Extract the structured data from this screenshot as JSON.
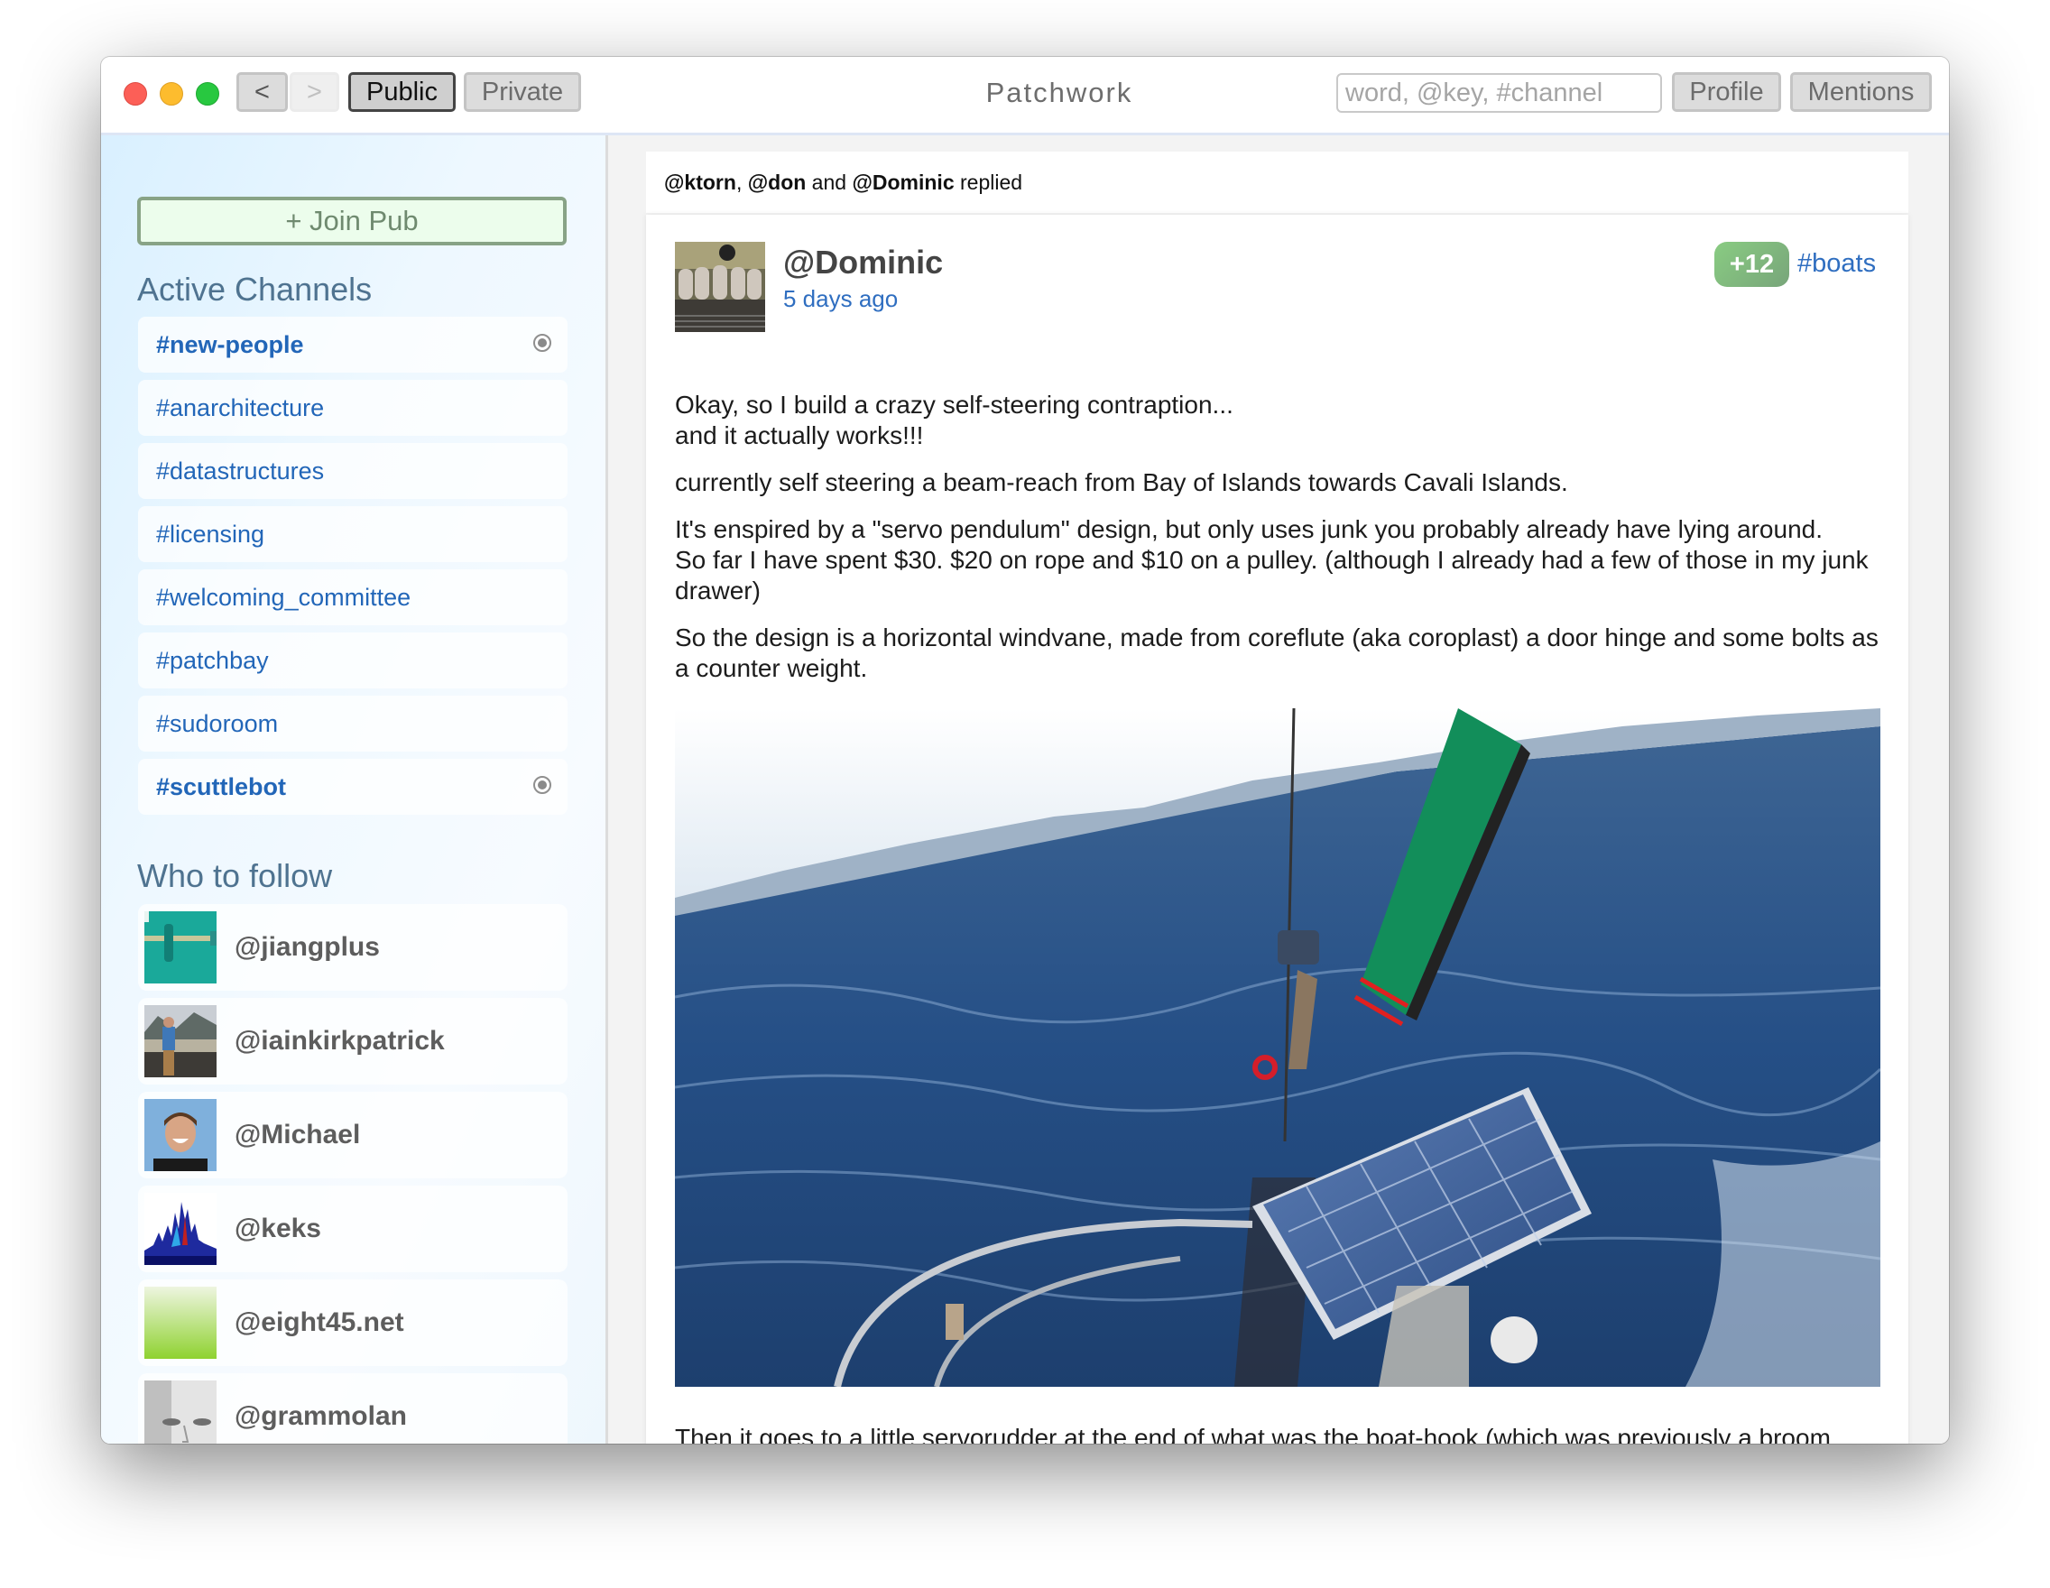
{
  "window": {
    "title": "Patchwork",
    "traffic_lights": [
      "close",
      "minimize",
      "zoom"
    ]
  },
  "header": {
    "back_label": "<",
    "forward_label": ">",
    "tabs": [
      {
        "label": "Public",
        "active": true
      },
      {
        "label": "Private",
        "active": false
      }
    ],
    "search_placeholder": "word, @key, #channel",
    "search_value": "",
    "profile_label": "Profile",
    "mentions_label": "Mentions"
  },
  "sidebar": {
    "join_pub_label": "+ Join Pub",
    "channels_heading": "Active Channels",
    "channels": [
      {
        "name": "#new-people",
        "bold": true,
        "subscribed": true
      },
      {
        "name": "#anarchitecture",
        "bold": false,
        "subscribed": false
      },
      {
        "name": "#datastructures",
        "bold": false,
        "subscribed": false
      },
      {
        "name": "#licensing",
        "bold": false,
        "subscribed": false
      },
      {
        "name": "#welcoming_committee",
        "bold": false,
        "subscribed": false
      },
      {
        "name": "#patchbay",
        "bold": false,
        "subscribed": false
      },
      {
        "name": "#sudoroom",
        "bold": false,
        "subscribed": false
      },
      {
        "name": "#scuttlebot",
        "bold": true,
        "subscribed": true
      }
    ],
    "follow_heading": "Who to follow",
    "follow": [
      {
        "name": "@jiangplus",
        "avatar": "teal-hinge-photo"
      },
      {
        "name": "@iainkirkpatrick",
        "avatar": "man-on-wall-photo"
      },
      {
        "name": "@Michael",
        "avatar": "smiling-man-photo"
      },
      {
        "name": "@keks",
        "avatar": "spectrogram-image"
      },
      {
        "name": "@eight45.net",
        "avatar": "green-gradient"
      },
      {
        "name": "@grammolan",
        "avatar": "grayscale-face-photo"
      }
    ]
  },
  "feed": {
    "reply_summary": {
      "users": [
        "@ktorn",
        "@don",
        "@Dominic"
      ],
      "sep_comma": ", ",
      "sep_and": " and ",
      "suffix": " replied"
    },
    "post": {
      "author": "@Dominic",
      "timestamp": "5 days ago",
      "votes": "+12",
      "channel": "#boats",
      "paragraphs": [
        [
          "Okay, so I build a crazy self-steering contraption...",
          "and it actually works!!!"
        ],
        [
          "currently self steering a beam-reach from Bay of Islands towards Cavali Islands."
        ],
        [
          "It's enspired by a \"servo pendulum\" design, but only uses junk you probably already have lying around.",
          "So far I have spent $30. $20 on rope and $10 on a pulley. (although I already had a few of those in my junk drawer)"
        ],
        [
          "So the design is a horizontal windvane, made from coreflute (aka coroplast) a door hinge and some bolts as a counter weight."
        ]
      ],
      "image_alt": "Self-steering windvane with green vane and solar panel on sailboat stern, open sea and islands behind",
      "continuation": "Then it goes to a little servorudder at the end of what was the boat-hook (which was previously a broom"
    }
  },
  "colors": {
    "link_blue": "#2266b8",
    "vote_green": "#89cc82",
    "join_border": "#88a386",
    "heading_blue": "#4f7390"
  }
}
